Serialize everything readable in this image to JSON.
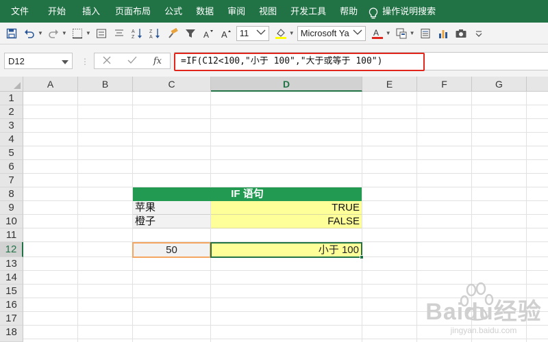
{
  "ribbon": {
    "tabs": [
      "文件",
      "开始",
      "插入",
      "页面布局",
      "公式",
      "数据",
      "审阅",
      "视图",
      "开发工具",
      "帮助"
    ],
    "help_search": "操作说明搜索"
  },
  "toolbar": {
    "font_size": "11",
    "font_name": "Microsoft Ya",
    "icons": [
      "save-icon",
      "undo-icon",
      "redo-icon",
      "borders-icon",
      "center-align-icon",
      "align-icon",
      "sort-ascending-icon",
      "sort-descending-icon",
      "format-painter-icon",
      "filter-icon",
      "decrease-font-icon",
      "increase-font-icon",
      "fill-color-icon",
      "font-color-icon",
      "format-icon",
      "form-icon",
      "chart-icon",
      "camera-icon",
      "customize-icon"
    ]
  },
  "formula_bar": {
    "name_box": "D12",
    "fx_label": "fx",
    "formula": "=IF(C12<100,\"小于 100\",\"大于或等于 100\")"
  },
  "sheet": {
    "columns": [
      "A",
      "B",
      "C",
      "D",
      "E",
      "F",
      "G"
    ],
    "rows": [
      "1",
      "2",
      "3",
      "4",
      "5",
      "6",
      "7",
      "8",
      "9",
      "10",
      "11",
      "12",
      "13",
      "14",
      "15",
      "16",
      "17",
      "18"
    ],
    "selected_column": "D",
    "selected_row": "12",
    "table_title": "IF 语句",
    "row9_label": "苹果",
    "row9_value": "TRUE",
    "row10_label": "橙子",
    "row10_value": "FALSE",
    "c12_value": "50",
    "d12_value": "小于 100"
  },
  "watermark": {
    "text": "Baidu经验",
    "subtext": "jingyan.baidu.com"
  },
  "colors": {
    "ribbon_green": "#217346",
    "title_green": "#229a52",
    "yellow_fill": "#ffff99",
    "highlight_red": "#e1251b",
    "input_border": "#f4a55f"
  }
}
